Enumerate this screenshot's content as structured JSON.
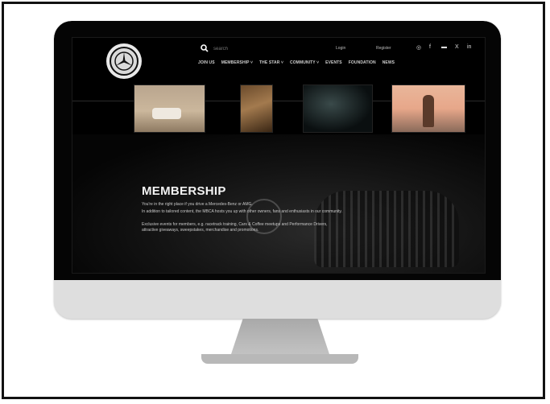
{
  "site": {
    "search": {
      "placeholder": "search"
    },
    "top_links": {
      "login": "Login",
      "register": "Register"
    },
    "social_icons": [
      "instagram-icon",
      "facebook-icon",
      "youtube-icon",
      "x-icon",
      "linkedin-icon"
    ],
    "social_glyphs": {
      "instagram": "◎",
      "facebook": "f",
      "youtube": "▬",
      "x": "X",
      "linkedin": "in"
    },
    "nav": [
      "JOIN US",
      "MEMBERSHIP ˅",
      "THE STAR ˅",
      "COMMUNITY ˅",
      "EVENTS",
      "FOUNDATION",
      "NEWS"
    ],
    "hero": {
      "title": "MEMBERSHIP",
      "lines": [
        "You're in the right place if you drive a Mercedes-Benz or AMG.",
        "In addition to tailored content, the MBCA hosts you up with other owners, fans and enthusiasts in our community.",
        "Exclusive events for members, e.g. racetrack training, Cars & Coffee meetups and Performance Drivers, attractive giveaways, sweepstakes, merchandise and promotions."
      ]
    }
  },
  "colors": {
    "screen_bg": "#000000",
    "bezel": "#050505",
    "monitor_body": "#dcdcdc",
    "stand": "#b8b8b8"
  }
}
